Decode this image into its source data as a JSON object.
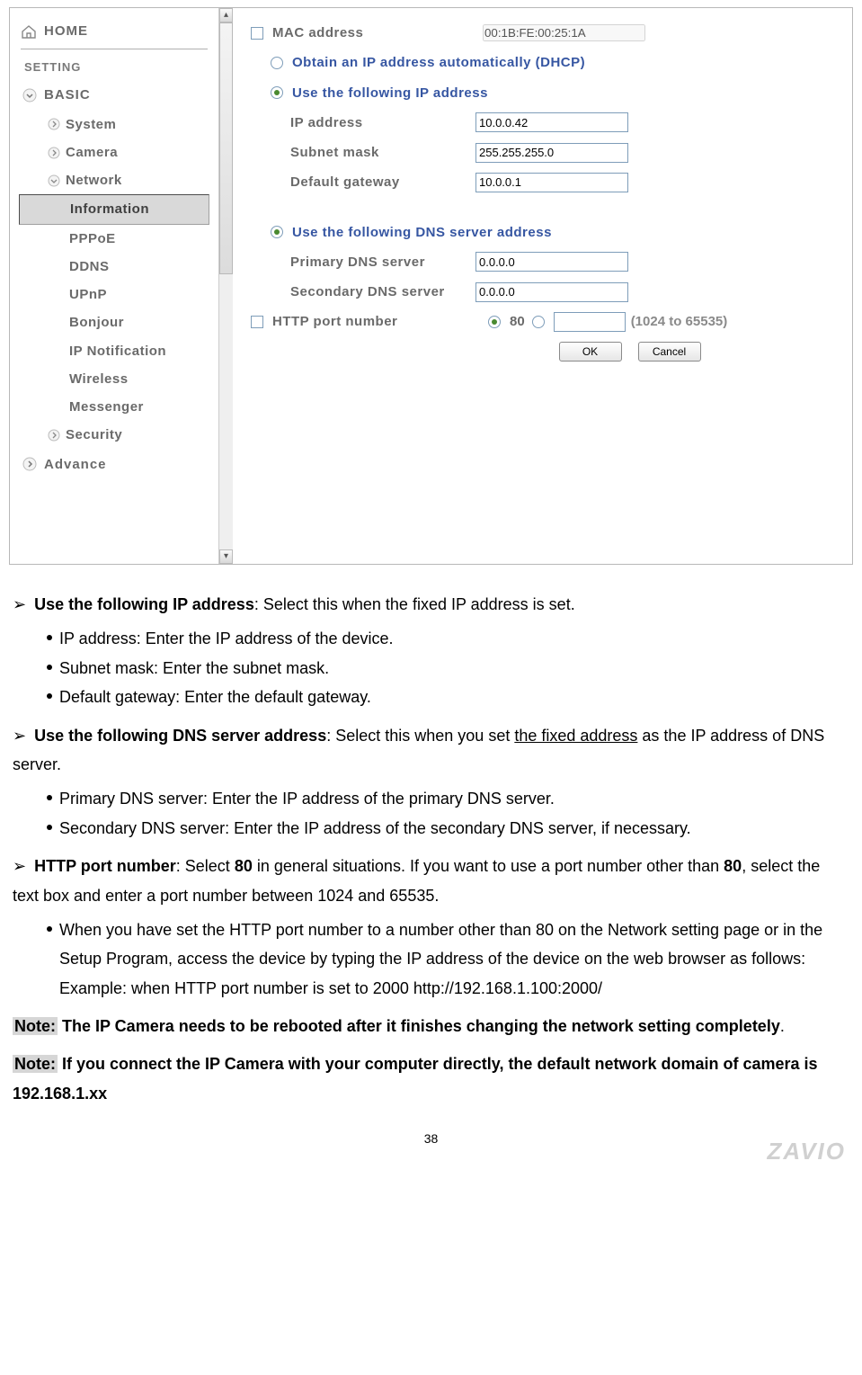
{
  "sidebar": {
    "home": "HOME",
    "setting": "SETTING",
    "basic": "BASIC",
    "items": {
      "system": "System",
      "camera": "Camera",
      "network": "Network"
    },
    "network_children": {
      "information": "Information",
      "pppoe": "PPPoE",
      "ddns": "DDNS",
      "upnp": "UPnP",
      "bonjour": "Bonjour",
      "ipnotif": "IP Notification",
      "wireless": "Wireless",
      "messenger": "Messenger"
    },
    "security": "Security",
    "advance": "Advance"
  },
  "form": {
    "mac_label": "MAC address",
    "mac_value": "00:1B:FE:00:25:1A",
    "dhcp_label": "Obtain an IP address automatically (DHCP)",
    "useip_label": "Use the following IP address",
    "ip_label": "IP address",
    "ip_value": "10.0.0.42",
    "subnet_label": "Subnet mask",
    "subnet_value": "255.255.255.0",
    "gw_label": "Default gateway",
    "gw_value": "10.0.0.1",
    "usedns_label": "Use the following DNS server address",
    "dns1_label": "Primary DNS server",
    "dns1_value": "0.0.0.0",
    "dns2_label": "Secondary DNS server",
    "dns2_value": "0.0.0.0",
    "http_label": "HTTP port number",
    "http_default": "80",
    "http_hint": "(1024 to 65535)",
    "ok": "OK",
    "cancel": "Cancel"
  },
  "doc": {
    "p1_b": "Use the following IP address",
    "p1_rest": ": Select this when the fixed IP address is set.",
    "b1": "IP address: Enter the IP address of the device.",
    "b2": "Subnet mask: Enter the subnet mask.",
    "b3": "Default gateway: Enter the default gateway.",
    "p2_b": "Use the following DNS server address",
    "p2_rest1": ": Select this when you set ",
    "p2_underline": "the fixed address",
    "p2_rest2": " as the IP address of DNS server.",
    "b4": "Primary DNS server: Enter the IP address of the primary DNS server.",
    "b5": "Secondary DNS server: Enter the IP address of the secondary DNS server, if necessary.",
    "p3_b": "HTTP port number",
    "p3_rest1": ": Select ",
    "p3_bold80a": "80",
    "p3_rest2": " in general situations. If you want to use a port number other than ",
    "p3_bold80b": "80",
    "p3_rest3": ", select the text box and enter a port number between 1024 and 65535.",
    "b6": "When you have set the HTTP port number to a number other than 80 on the Network setting page or in the Setup Program, access the device by typing the IP address of the device on the web browser as follows: Example: when HTTP port number is set to 2000 http://192.168.1.100:2000/",
    "note1_label": "Note:",
    "note1_rest": " The IP Camera needs to be rebooted after it finishes changing the network setting completely",
    "note2_label": "Note:",
    "note2_rest": " If you connect the IP Camera with your computer directly, the default network domain of camera is 192.168.1.xx",
    "page": "38",
    "logo": "ZAVIO"
  }
}
